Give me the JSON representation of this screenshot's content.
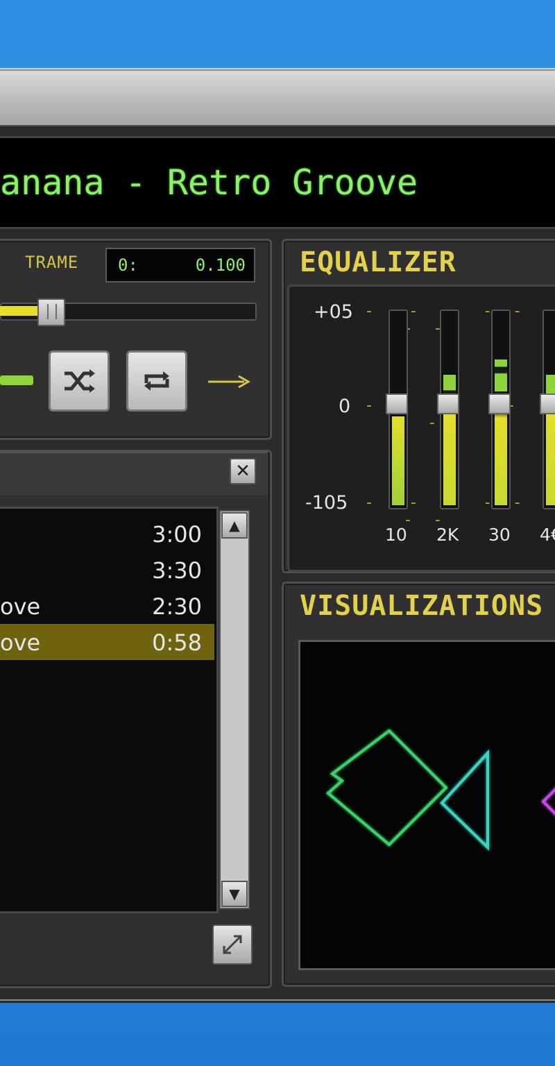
{
  "now_playing": {
    "text": "anana - Retro Groove"
  },
  "frame": {
    "label": "TRAME",
    "lcd_left": "0:",
    "lcd_right": "0.100"
  },
  "seek": {
    "progress": 0.16
  },
  "equalizer": {
    "title": "EQUALIZER",
    "scale": {
      "top": "+05",
      "mid": "0",
      "bottom": "-105"
    },
    "bands": [
      {
        "label": "10",
        "level": 0.0
      },
      {
        "label": "2K",
        "level": 0.0
      },
      {
        "label": "30",
        "level": 0.0
      },
      {
        "label": "4€",
        "level": 0.0
      }
    ]
  },
  "playlist": {
    "tracks": [
      {
        "name": "",
        "duration": "3:00"
      },
      {
        "name": "",
        "duration": "3:30"
      },
      {
        "name": "ove",
        "duration": "2:30"
      },
      {
        "name": "ove",
        "duration": "0:58",
        "selected": true
      }
    ]
  },
  "visualizations": {
    "title": "VISUALIZATIONS"
  },
  "icons": {
    "shuffle": "shuffle-icon",
    "repeat": "repeat-icon",
    "close": "close-icon",
    "scroll_up": "scroll-up-icon",
    "scroll_down": "scroll-down-icon",
    "resize": "resize-icon"
  },
  "colors": {
    "lcd_green": "#8df06a",
    "accent_yellow": "#e1d14c",
    "selected_row": "#6e6410"
  }
}
